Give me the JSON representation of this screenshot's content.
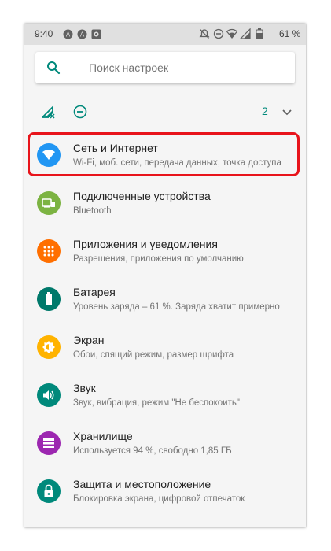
{
  "status_bar": {
    "time": "9:40",
    "battery_percent": "61 %",
    "left_icons": [
      "circle-a-icon",
      "circle-a-icon",
      "camera-icon"
    ],
    "right_icons": [
      "mute-icon",
      "do-not-disturb-icon",
      "wifi-icon",
      "signal-icon",
      "battery-icon"
    ]
  },
  "search": {
    "placeholder": "Поиск настроек"
  },
  "quick_settings": {
    "icons": [
      "no-sim-signal-icon",
      "do-not-disturb-icon"
    ],
    "count": "2",
    "expand_icon": "chevron-down-icon"
  },
  "settings_items": [
    {
      "title": "Сеть и Интернет",
      "subtitle": "Wi-Fi, моб. сети, передача данных, точка доступа",
      "icon": "wifi-icon",
      "color": "#2196f3"
    },
    {
      "title": "Подключенные устройства",
      "subtitle": "Bluetooth",
      "icon": "devices-icon",
      "color": "#7cb342"
    },
    {
      "title": "Приложения и уведомления",
      "subtitle": "Разрешения, приложения по умолчанию",
      "icon": "apps-icon",
      "color": "#ff6f00"
    },
    {
      "title": "Батарея",
      "subtitle": "Уровень заряда – 61 %. Заряда хватит примерно",
      "icon": "battery-icon",
      "color": "#00796b"
    },
    {
      "title": "Экран",
      "subtitle": "Обои, спящий режим, размер шрифта",
      "icon": "brightness-icon",
      "color": "#ffb300"
    },
    {
      "title": "Звук",
      "subtitle": "Звук, вибрация, режим \"Не беспокоить\"",
      "icon": "volume-icon",
      "color": "#00897b"
    },
    {
      "title": "Хранилище",
      "subtitle": "Используется 94 %, свободно 1,85 ГБ",
      "icon": "storage-icon",
      "color": "#9c27b0"
    },
    {
      "title": "Защита и местоположение",
      "subtitle": "Блокировка экрана, цифровой отпечаток",
      "icon": "lock-icon",
      "color": "#00897b"
    }
  ],
  "highlight_color": "#e8141b"
}
